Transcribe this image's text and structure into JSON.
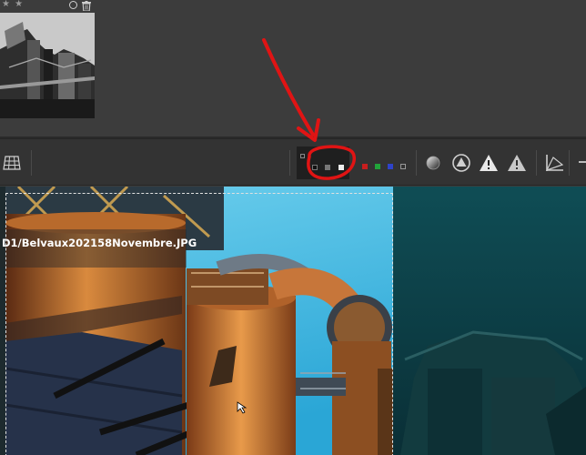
{
  "filmstrip": {
    "thumbnail": {
      "stars": "★ ★",
      "reject_icon": "circle-reject-icon",
      "trash_icon": "trash-icon"
    }
  },
  "toolbar": {
    "left_icon": "grid-overlay-icon",
    "preview_backgrounds": [
      "black",
      "gray",
      "white"
    ],
    "channels": [
      "red",
      "green",
      "blue",
      "luminance"
    ],
    "right_icons": [
      "focus-mask-icon",
      "clip-warning-shadows-icon",
      "clip-warning-highlights-icon",
      "clip-warning-icon",
      "gamut-icon"
    ]
  },
  "viewer": {
    "filename": "D1/Belvaux202158Novembre.JPG"
  },
  "annotation": {
    "color": "#e01414"
  }
}
